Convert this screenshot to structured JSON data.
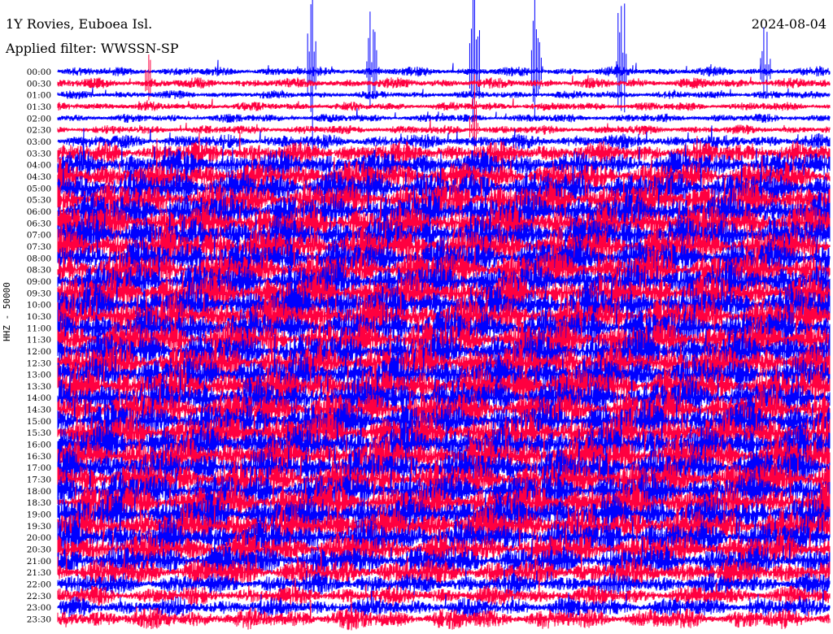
{
  "header": {
    "station": "1Y Rovies, Euboea Isl.",
    "filter": "Applied filter: WWSSN-SP",
    "date": "2024-08-04"
  },
  "chart_data": {
    "type": "line",
    "title": "1Y Rovies, Euboea Isl.",
    "ylabel": "HHZ - 50000",
    "xlabel": "",
    "minutes_per_line": 30,
    "colors": [
      "#0000ff",
      "#ff0040"
    ],
    "row_labels": [
      "00:00",
      "00:30",
      "01:00",
      "01:30",
      "02:00",
      "02:30",
      "03:00",
      "03:30",
      "04:00",
      "04:30",
      "05:00",
      "05:30",
      "06:00",
      "06:30",
      "07:00",
      "07:30",
      "08:00",
      "08:30",
      "09:00",
      "09:30",
      "10:00",
      "10:30",
      "11:00",
      "11:30",
      "12:00",
      "12:30",
      "13:00",
      "13:30",
      "14:00",
      "14:30",
      "15:00",
      "15:30",
      "16:00",
      "16:30",
      "17:00",
      "17:30",
      "18:00",
      "18:30",
      "19:00",
      "19:30",
      "20:00",
      "20:30",
      "21:00",
      "21:30",
      "22:00",
      "22:30",
      "23:00",
      "23:30"
    ],
    "relative_amplitude": [
      0.15,
      0.18,
      0.12,
      0.14,
      0.13,
      0.15,
      0.3,
      0.55,
      0.7,
      0.8,
      0.9,
      0.95,
      1,
      1,
      1,
      1,
      1,
      1,
      1,
      1,
      1,
      1,
      1,
      1,
      1,
      1,
      1,
      1,
      1,
      1,
      1,
      1,
      1,
      1,
      1,
      1,
      1,
      1,
      1,
      0.95,
      0.9,
      0.85,
      0.8,
      0.7,
      0.5,
      0.45,
      0.45,
      0.5
    ],
    "events": [
      {
        "row": 0,
        "minute": 9.9,
        "relative_amplitude": 8
      },
      {
        "row": 0,
        "minute": 12.2,
        "relative_amplitude": 5
      },
      {
        "row": 0,
        "minute": 16.2,
        "relative_amplitude": 9
      },
      {
        "row": 0,
        "minute": 18.6,
        "relative_amplitude": 6
      },
      {
        "row": 0,
        "minute": 21.9,
        "relative_amplitude": 7
      },
      {
        "row": 0,
        "minute": 27.5,
        "relative_amplitude": 4
      },
      {
        "row": 1,
        "minute": 3.6,
        "relative_amplitude": 3
      },
      {
        "row": 5,
        "minute": 16.2,
        "relative_amplitude": 4
      }
    ]
  }
}
